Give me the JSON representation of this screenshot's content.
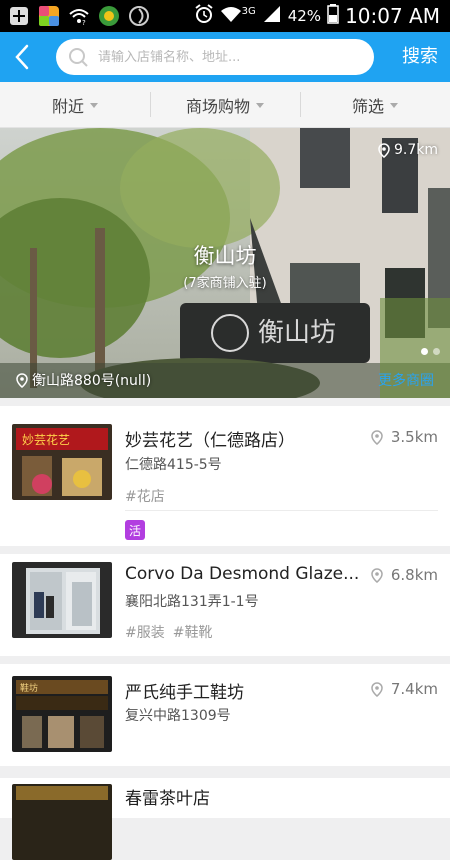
{
  "status_bar": {
    "battery_pct": "42%",
    "time": "10:07 AM",
    "network": "3G"
  },
  "header": {
    "search_placeholder": "请输入店铺名称、地址...",
    "search_button": "搜索",
    "accent_color": "#1fa3f2"
  },
  "filters": [
    {
      "label": "附近"
    },
    {
      "label": "商场购物"
    },
    {
      "label": "筛选"
    }
  ],
  "banner": {
    "title": "衡山坊",
    "subtitle": "(7家商铺入驻)",
    "distance": "9.7km",
    "address": "衡山路880号(null)",
    "more_link": "更多商圈",
    "page_count": 2,
    "active_page": 1
  },
  "shops": [
    {
      "name": "妙芸花艺（仁德路店）",
      "address": "仁德路415-5号",
      "distance": "3.5km",
      "tags": [
        "#花店"
      ],
      "badge": "活"
    },
    {
      "name": "Corvo Da Desmond Glaze...",
      "address": "襄阳北路131弄1-1号",
      "distance": "6.8km",
      "tags": [
        "#服装",
        "#鞋靴"
      ],
      "badge": ""
    },
    {
      "name": "严氏纯手工鞋坊",
      "address": "复兴中路1309号",
      "distance": "7.4km",
      "tags": [],
      "badge": ""
    },
    {
      "name": "春雷茶叶店",
      "address": "",
      "distance": "",
      "tags": [],
      "badge": ""
    }
  ]
}
